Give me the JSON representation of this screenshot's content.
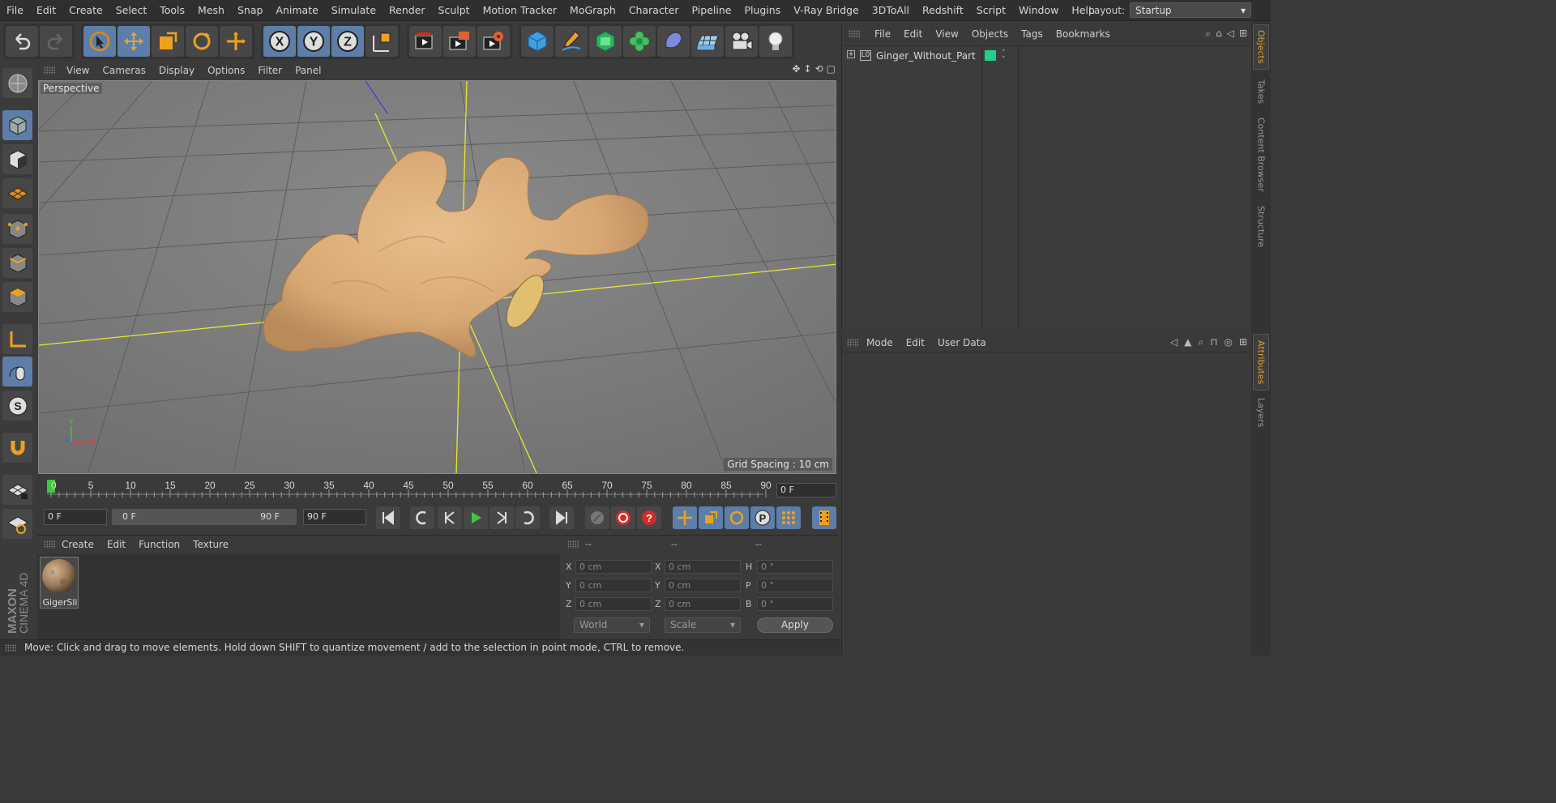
{
  "menubar": {
    "items": [
      "File",
      "Edit",
      "Create",
      "Select",
      "Tools",
      "Mesh",
      "Snap",
      "Animate",
      "Simulate",
      "Render",
      "Sculpt",
      "Motion Tracker",
      "MoGraph",
      "Character",
      "Pipeline",
      "Plugins",
      "V-Ray Bridge",
      "3DToAll",
      "Redshift",
      "Script",
      "Window",
      "Help"
    ],
    "layout_label": "Layout:",
    "layout_value": "Startup"
  },
  "toolbar": {
    "icons": [
      "undo-icon",
      "redo-icon",
      "live-selection-icon",
      "move-icon",
      "scale-icon",
      "rotate-icon",
      "transform-icon",
      "x-axis-icon",
      "y-axis-icon",
      "z-axis-icon",
      "coordinate-system-icon",
      "render-view-icon",
      "render-picture-viewer-icon",
      "render-settings-icon",
      "cube-icon",
      "pen-icon",
      "subdivision-icon",
      "cloner-icon",
      "deformer-icon",
      "floor-icon",
      "camera-icon",
      "light-icon"
    ],
    "axis_labels": [
      "X",
      "Y",
      "Z"
    ]
  },
  "viewport": {
    "menu": [
      "View",
      "Cameras",
      "Display",
      "Options",
      "Filter",
      "Panel"
    ],
    "label": "Perspective",
    "grid_spacing": "Grid Spacing : 10 cm",
    "axis_labels": {
      "x": "X",
      "y": "Y"
    }
  },
  "timeline": {
    "ticks": [
      "0",
      "5",
      "10",
      "15",
      "20",
      "25",
      "30",
      "35",
      "40",
      "45",
      "50",
      "55",
      "60",
      "65",
      "70",
      "75",
      "80",
      "85",
      "90"
    ],
    "current_frame": "0 F"
  },
  "transport": {
    "start_field": "0 F",
    "range_start": "0 F",
    "range_end": "90 F",
    "end_field": "90 F"
  },
  "material_manager": {
    "menu": [
      "Create",
      "Edit",
      "Function",
      "Texture"
    ],
    "material_name": "GigerSli"
  },
  "coordinates": {
    "headers": [
      "--",
      "--",
      "--"
    ],
    "rows": [
      {
        "l1": "X",
        "v1": "0 cm",
        "l2": "X",
        "v2": "0 cm",
        "l3": "H",
        "v3": "0 °"
      },
      {
        "l1": "Y",
        "v1": "0 cm",
        "l2": "Y",
        "v2": "0 cm",
        "l3": "P",
        "v3": "0 °"
      },
      {
        "l1": "Z",
        "v1": "0 cm",
        "l2": "Z",
        "v2": "0 cm",
        "l3": "B",
        "v3": "0 °"
      }
    ],
    "mode_dropdown": "World",
    "size_dropdown": "Scale",
    "apply_label": "Apply"
  },
  "statusbar": {
    "text": "Move: Click and drag to move elements. Hold down SHIFT to quantize movement / add to the selection in point mode, CTRL to remove."
  },
  "brand": {
    "line1": "MAXON",
    "line2": "CINEMA 4D"
  },
  "objects_panel": {
    "menu": [
      "File",
      "Edit",
      "View",
      "Objects",
      "Tags",
      "Bookmarks"
    ],
    "object_name": "Ginger_Without_Part",
    "layer_color": "#1fcf8a"
  },
  "attributes_panel": {
    "menu": [
      "Mode",
      "Edit",
      "User Data"
    ]
  },
  "side_tabs": {
    "top": [
      "Objects",
      "Takes",
      "Content Browser",
      "Structure"
    ],
    "bottom": [
      "Attributes",
      "Layers"
    ]
  },
  "colors": {
    "accent_blue": "#5d7ea8",
    "highlight_orange": "#e0a030",
    "axis_yellow": "#e8e82a",
    "play_green": "#3ec83e"
  }
}
